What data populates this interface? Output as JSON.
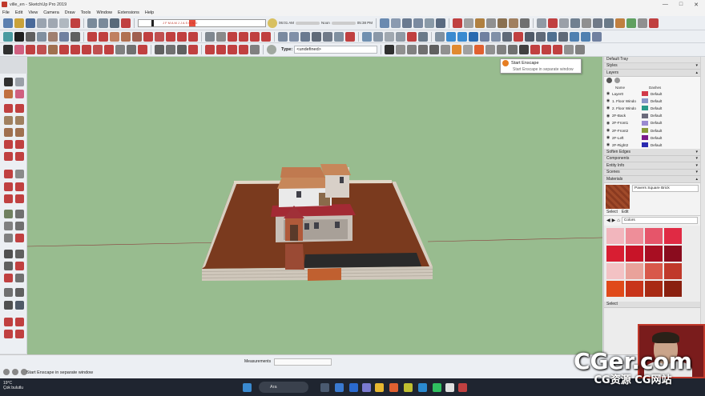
{
  "window": {
    "title": "ville_en - SketchUp Pro 2019",
    "minimize": "—",
    "maximize": "□",
    "close": "✕"
  },
  "menu": [
    "File",
    "Edit",
    "View",
    "Camera",
    "Draw",
    "Tools",
    "Window",
    "Extensions",
    "Help"
  ],
  "shadow_settings": {
    "months": "J F M A M J J A S O N D",
    "time_start": "06:01 AM",
    "time_noon": "Noon",
    "time_end": "05:38 PM"
  },
  "type_box": {
    "label": "Type:",
    "value": "<undefined>"
  },
  "tooltip": {
    "title": "Start Enscape",
    "desc": "Start Enscape in separate window"
  },
  "tray": {
    "title": "Default Tray",
    "sections_top": [
      "Styles",
      "Layers"
    ],
    "layers": {
      "col_name": "Name",
      "col_dashes": "Dashes",
      "rows": [
        {
          "name": "Layer0",
          "color": "#d23a4a",
          "dash": "Default"
        },
        {
          "name": "1. Floor Windo",
          "color": "#8a96c8",
          "dash": "Default"
        },
        {
          "name": "2. Floor Windo",
          "color": "#2a9a8a",
          "dash": "Default"
        },
        {
          "name": "2F-Back",
          "color": "#6a6a7a",
          "dash": "Default"
        },
        {
          "name": "2F-Front1",
          "color": "#9a8ad0",
          "dash": "Default"
        },
        {
          "name": "2F-Front2",
          "color": "#8a9a3a",
          "dash": "Default"
        },
        {
          "name": "2F-Left",
          "color": "#7a1a8a",
          "dash": "Default"
        },
        {
          "name": "2F-Right2",
          "color": "#2a2ab0",
          "dash": "Default"
        }
      ]
    },
    "sections_mid": [
      "Soften Edges",
      "Components",
      "Entity Info",
      "Scenes",
      "Materials"
    ],
    "material": {
      "name": "Pavers Square Brick",
      "tab_select": "Select",
      "tab_edit": "Edit",
      "library": "Colors"
    },
    "swatches": [
      "#f2b6bd",
      "#ee8e99",
      "#e6556a",
      "#e02a44",
      "#d81e32",
      "#c81428",
      "#a80e22",
      "#8a0c1e",
      "#f3c2c4",
      "#e9a29a",
      "#d8584a",
      "#c0392b",
      "#e04a1a",
      "#c8341a",
      "#a82a14",
      "#8a2010"
    ],
    "select_section": "Select"
  },
  "measurements": {
    "label": "Measurements"
  },
  "status": {
    "text": "Start Enscape in separate window"
  },
  "taskbar": {
    "weather_temp": "19°C",
    "weather_desc": "Çok bulutlu",
    "search": "Ara"
  },
  "watermark": {
    "big": "CGer.com",
    "small": "CG资源 CG网站"
  }
}
